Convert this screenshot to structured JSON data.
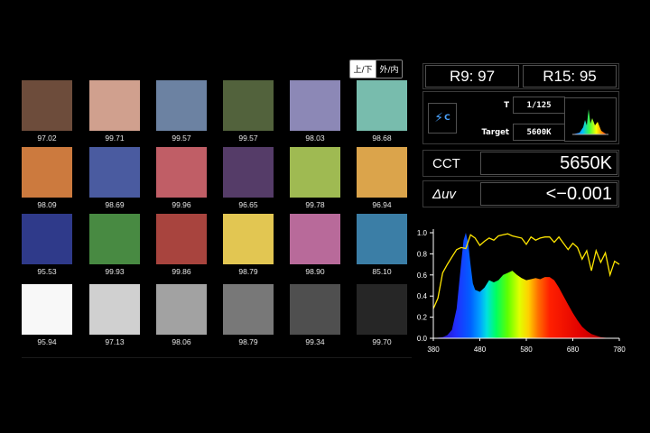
{
  "toggle": {
    "active": "上/下",
    "inactive": "外/内"
  },
  "swatches": [
    {
      "color": "#6d4c3b",
      "value": "97.02"
    },
    {
      "color": "#d0a08e",
      "value": "99.71"
    },
    {
      "color": "#6c82a2",
      "value": "99.57"
    },
    {
      "color": "#52623c",
      "value": "99.57"
    },
    {
      "color": "#8c88b6",
      "value": "98.03"
    },
    {
      "color": "#78bcad",
      "value": "98.68"
    },
    {
      "color": "#cc7a3e",
      "value": "98.09"
    },
    {
      "color": "#4a5ba0",
      "value": "98.69"
    },
    {
      "color": "#c05e66",
      "value": "99.96"
    },
    {
      "color": "#553c68",
      "value": "96.65"
    },
    {
      "color": "#9fba52",
      "value": "99.78"
    },
    {
      "color": "#dba44b",
      "value": "96.94"
    },
    {
      "color": "#2f3a8a",
      "value": "95.53"
    },
    {
      "color": "#488a42",
      "value": "99.93"
    },
    {
      "color": "#a8443e",
      "value": "99.86"
    },
    {
      "color": "#e2c652",
      "value": "98.79"
    },
    {
      "color": "#b86a9a",
      "value": "98.90"
    },
    {
      "color": "#3b7ea6",
      "value": "85.10"
    },
    {
      "color": "#f8f8f8",
      "value": "95.94"
    },
    {
      "color": "#d0d0d0",
      "value": "97.13"
    },
    {
      "color": "#a2a2a2",
      "value": "98.06"
    },
    {
      "color": "#787878",
      "value": "98.79"
    },
    {
      "color": "#4f4f4f",
      "value": "99.34"
    },
    {
      "color": "#262626",
      "value": "99.70"
    }
  ],
  "r_values": {
    "r9": "R9: 97",
    "r15": "R15: 95"
  },
  "mode": {
    "t_label": "T",
    "t_value": "1/125",
    "target_label": "Target",
    "target_value": "5600K"
  },
  "cct": {
    "label": "CCT",
    "value": "5650K"
  },
  "duv": {
    "label": "Δuv",
    "value": "<−0.001"
  },
  "chart_data": {
    "type": "area",
    "x_ticks": [
      "380",
      "480",
      "580",
      "680",
      "780"
    ],
    "y_ticks": [
      "1.0",
      "0.8",
      "0.6",
      "0.4",
      "0.2",
      "0.0"
    ],
    "xlim": [
      380,
      780
    ],
    "ylim": [
      0,
      1
    ],
    "series": [
      {
        "x": [
          380,
          400,
          410,
          420,
          430,
          440,
          445,
          450,
          455,
          460,
          465,
          470,
          480,
          490,
          500,
          510,
          520,
          530,
          540,
          550,
          560,
          570,
          580,
          590,
          600,
          610,
          620,
          630,
          640,
          650,
          660,
          670,
          680,
          690,
          700,
          710,
          720,
          740,
          760,
          780
        ],
        "values": [
          0.0,
          0.01,
          0.03,
          0.08,
          0.28,
          0.72,
          0.93,
          1.0,
          0.9,
          0.7,
          0.52,
          0.46,
          0.44,
          0.48,
          0.55,
          0.53,
          0.55,
          0.6,
          0.62,
          0.64,
          0.6,
          0.57,
          0.55,
          0.56,
          0.57,
          0.56,
          0.58,
          0.58,
          0.55,
          0.48,
          0.4,
          0.32,
          0.24,
          0.17,
          0.11,
          0.07,
          0.04,
          0.01,
          0.0,
          0.0
        ]
      },
      {
        "x": [
          380,
          390,
          400,
          410,
          420,
          430,
          440,
          450,
          460,
          470,
          480,
          490,
          500,
          510,
          520,
          530,
          540,
          550,
          560,
          570,
          580,
          590,
          600,
          610,
          620,
          630,
          640,
          650,
          660,
          670,
          680,
          690,
          700,
          710,
          720,
          730,
          740,
          750,
          760,
          770,
          780
        ],
        "values": [
          0.28,
          0.38,
          0.62,
          0.7,
          0.77,
          0.84,
          0.86,
          0.85,
          0.98,
          0.95,
          0.88,
          0.92,
          0.95,
          0.93,
          0.97,
          0.98,
          0.99,
          0.97,
          0.96,
          0.95,
          0.89,
          0.96,
          0.93,
          0.95,
          0.96,
          0.96,
          0.91,
          0.96,
          0.9,
          0.84,
          0.9,
          0.86,
          0.75,
          0.83,
          0.64,
          0.83,
          0.72,
          0.81,
          0.6,
          0.73,
          0.7
        ]
      }
    ],
    "colors": {
      "line": "#ffe600",
      "axis": "#ffffff",
      "grid": "#2a2a2a"
    }
  }
}
